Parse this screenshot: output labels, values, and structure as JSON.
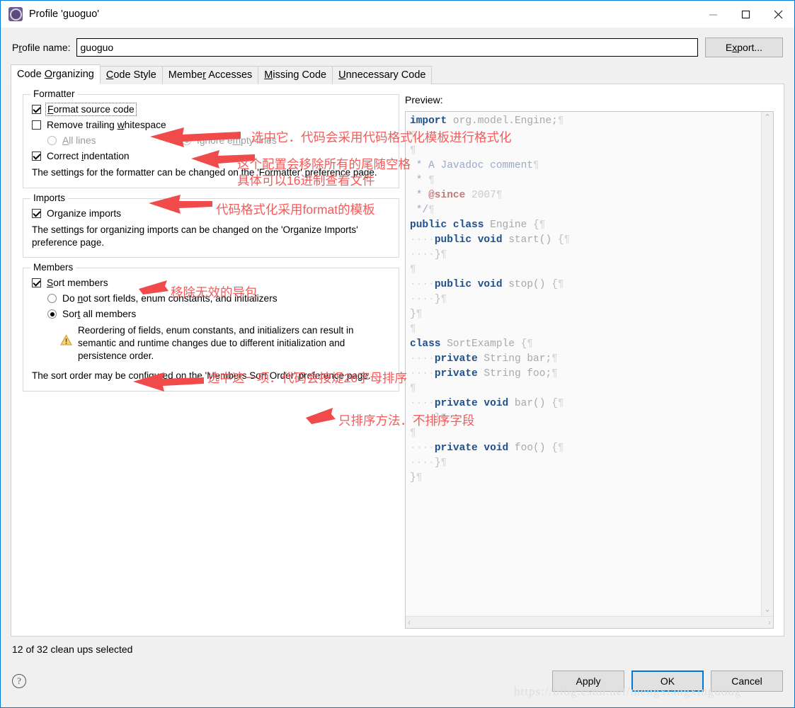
{
  "window": {
    "title": "Profile 'guoguo'",
    "icon": "profile-gear-icon",
    "minimize": "—",
    "maximize": "□",
    "close": "✕"
  },
  "profile": {
    "label_pre": "P",
    "label_accel": "r",
    "label_post": "ofile name:",
    "name_value": "guoguo",
    "name_placeholder": "",
    "export_pre": "E",
    "export_accel": "x",
    "export_post": "port..."
  },
  "tabs": [
    {
      "pre": "Code ",
      "accel": "O",
      "post": "rganizing",
      "active": true
    },
    {
      "pre": "",
      "accel": "C",
      "post": "ode Style",
      "active": false
    },
    {
      "pre": "Membe",
      "accel": "r",
      "post": " Accesses",
      "active": false
    },
    {
      "pre": "",
      "accel": "M",
      "post": "issing Code",
      "active": false
    },
    {
      "pre": "",
      "accel": "U",
      "post": "nnecessary Code",
      "active": false
    }
  ],
  "formatter": {
    "group_title": "Formatter",
    "format_source": {
      "pre": "F",
      "accel": "",
      "post": "ormat source code",
      "checked": true,
      "focused": true
    },
    "remove_trailing": {
      "pre": "Remove trailing ",
      "accel": "w",
      "post": "hitespace",
      "checked": false
    },
    "all_lines": {
      "pre": "",
      "accel": "A",
      "post": "ll lines",
      "selected": false,
      "disabled": true
    },
    "ignore_empty": {
      "pre": "Ignore e",
      "accel": "m",
      "post": "pty lines",
      "selected": true,
      "disabled": true
    },
    "correct_indent": {
      "pre": "Correct ",
      "accel": "i",
      "post": "ndentation",
      "checked": true
    },
    "description": "The settings for the formatter can be changed on the 'Formatter' preference page."
  },
  "imports": {
    "group_title": "Imports",
    "organize": {
      "pre": "Or",
      "accel": "g",
      "post": "anize imports",
      "checked": true
    },
    "description": "The settings for organizing imports can be changed on the 'Organize Imports' preference page."
  },
  "members": {
    "group_title": "Members",
    "sort_members": {
      "pre": "",
      "accel": "S",
      "post": "ort members",
      "checked": true
    },
    "do_not_sort": {
      "pre": "Do ",
      "accel": "n",
      "post": "ot sort fields, enum constants, and initializers",
      "selected": false
    },
    "sort_all": {
      "pre": "Sor",
      "accel": "t",
      "post": " all members",
      "selected": true
    },
    "warning": "Reordering of fields, enum constants, and initializers can result in semantic and runtime changes due to different initialization and persistence order.",
    "warning_icon": "warning-triangle-icon",
    "description": "The sort order may be configured on the 'Members Sort Order' preference page."
  },
  "preview": {
    "label": "Preview:",
    "code_lines": [
      [
        {
          "t": "import",
          "c": "kw"
        },
        {
          "t": " org",
          "c": "id"
        },
        {
          "t": ".",
          "c": "id"
        },
        {
          "t": "model",
          "c": "id"
        },
        {
          "t": ".",
          "c": "id"
        },
        {
          "t": "Engine;",
          "c": "id"
        },
        {
          "t": "¶",
          "c": "pil"
        }
      ],
      [
        {
          "t": "¶",
          "c": "pil"
        }
      ],
      [
        {
          "t": "¶",
          "c": "pil"
        }
      ],
      [
        {
          "t": " * A Javadoc comment",
          "c": "cmt"
        },
        {
          "t": "¶",
          "c": "pil"
        }
      ],
      [
        {
          "t": " * ",
          "c": "cmt"
        },
        {
          "t": "¶",
          "c": "pil"
        }
      ],
      [
        {
          "t": " * ",
          "c": "cmt"
        },
        {
          "t": "@since",
          "c": "ann"
        },
        {
          "t": " 2007",
          "c": "num"
        },
        {
          "t": "¶",
          "c": "pil"
        }
      ],
      [
        {
          "t": " */",
          "c": "cmt"
        },
        {
          "t": "¶",
          "c": "pil"
        }
      ],
      [
        {
          "t": "public class",
          "c": "kw"
        },
        {
          "t": " Engine ",
          "c": "id"
        },
        {
          "t": "{",
          "c": "brace"
        },
        {
          "t": "¶",
          "c": "pil"
        }
      ],
      [
        {
          "t": "····",
          "c": "dot"
        },
        {
          "t": "public void",
          "c": "kw"
        },
        {
          "t": " start() ",
          "c": "id"
        },
        {
          "t": "{",
          "c": "brace"
        },
        {
          "t": "¶",
          "c": "pil"
        }
      ],
      [
        {
          "t": "····",
          "c": "dot"
        },
        {
          "t": "}",
          "c": "brace"
        },
        {
          "t": "¶",
          "c": "pil"
        }
      ],
      [
        {
          "t": "¶",
          "c": "pil"
        }
      ],
      [
        {
          "t": "····",
          "c": "dot"
        },
        {
          "t": "public void",
          "c": "kw"
        },
        {
          "t": " stop() ",
          "c": "id"
        },
        {
          "t": "{",
          "c": "brace"
        },
        {
          "t": "¶",
          "c": "pil"
        }
      ],
      [
        {
          "t": "····",
          "c": "dot"
        },
        {
          "t": "}",
          "c": "brace"
        },
        {
          "t": "¶",
          "c": "pil"
        }
      ],
      [
        {
          "t": "}",
          "c": "brace"
        },
        {
          "t": "¶",
          "c": "pil"
        }
      ],
      [
        {
          "t": "¶",
          "c": "pil"
        }
      ],
      [
        {
          "t": "class",
          "c": "kw"
        },
        {
          "t": " SortExample ",
          "c": "id"
        },
        {
          "t": "{",
          "c": "brace"
        },
        {
          "t": "¶",
          "c": "pil"
        }
      ],
      [
        {
          "t": "····",
          "c": "dot"
        },
        {
          "t": "private",
          "c": "kw"
        },
        {
          "t": " String bar;",
          "c": "id"
        },
        {
          "t": "¶",
          "c": "pil"
        }
      ],
      [
        {
          "t": "····",
          "c": "dot"
        },
        {
          "t": "private",
          "c": "kw"
        },
        {
          "t": " String foo;",
          "c": "id"
        },
        {
          "t": "¶",
          "c": "pil"
        }
      ],
      [
        {
          "t": "¶",
          "c": "pil"
        }
      ],
      [
        {
          "t": "····",
          "c": "dot"
        },
        {
          "t": "private void",
          "c": "kw"
        },
        {
          "t": " bar() ",
          "c": "id"
        },
        {
          "t": "{",
          "c": "brace"
        },
        {
          "t": "¶",
          "c": "pil"
        }
      ],
      [
        {
          "t": "····",
          "c": "dot"
        },
        {
          "t": "}",
          "c": "brace"
        },
        {
          "t": "¶",
          "c": "pil"
        }
      ],
      [
        {
          "t": "¶",
          "c": "pil"
        }
      ],
      [
        {
          "t": "····",
          "c": "dot"
        },
        {
          "t": "private void",
          "c": "kw"
        },
        {
          "t": " foo() ",
          "c": "id"
        },
        {
          "t": "{",
          "c": "brace"
        },
        {
          "t": "¶",
          "c": "pil"
        }
      ],
      [
        {
          "t": "····",
          "c": "dot"
        },
        {
          "t": "}",
          "c": "brace"
        },
        {
          "t": "¶",
          "c": "pil"
        }
      ],
      [
        {
          "t": "}",
          "c": "brace"
        },
        {
          "t": "¶",
          "c": "pil"
        }
      ]
    ],
    "scroll_up": "⌃",
    "scroll_down": "⌄",
    "scroll_left": "‹",
    "scroll_right": "›"
  },
  "status": {
    "text": "12 of 32 clean ups selected"
  },
  "bottom": {
    "help": "?",
    "apply": "Apply",
    "ok": "OK",
    "cancel": "Cancel"
  },
  "annotations": [
    {
      "id": "a1",
      "text": "选中它．代码会采用代码格式化模板进行格式化"
    },
    {
      "id": "a2",
      "text": "这个配置会移除所有的尾随空格"
    },
    {
      "id": "a3",
      "text": "具体可以16进制查看文件"
    },
    {
      "id": "a4",
      "text": "代码格式化采用format的模板"
    },
    {
      "id": "a5",
      "text": "移除无效的导包"
    },
    {
      "id": "a6",
      "text": "选中这一项．代码会按煶26字母排序"
    },
    {
      "id": "a7",
      "text": "只排序方法．不排序字段"
    }
  ],
  "watermark": {
    "text": "https://blog.csdn.net/mengxiangxingdong"
  },
  "colors": {
    "accent": "#0078d7",
    "annotation": "#f25b5b",
    "keyword": "#20508c"
  }
}
